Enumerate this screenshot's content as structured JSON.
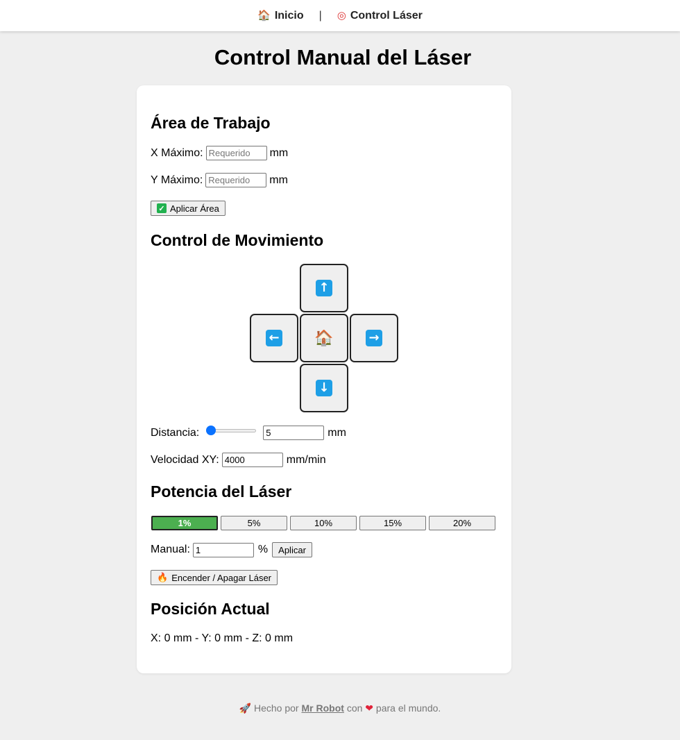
{
  "nav": {
    "home_icon": "house-emoji",
    "home_label": "Inicio",
    "separator": "|",
    "control_icon": "target-emoji",
    "control_label": "Control Láser"
  },
  "page_title": "Control Manual del Láser",
  "work_area": {
    "heading": "Área de Trabajo",
    "x_label": "X Máximo:",
    "x_placeholder": "Requerido",
    "x_unit": "mm",
    "y_label": "Y Máximo:",
    "y_placeholder": "Requerido",
    "y_unit": "mm",
    "apply_icon": "check-box-icon",
    "apply_label": "Aplicar Área"
  },
  "movement": {
    "heading": "Control de Movimiento",
    "up_icon": "arrow-up-icon",
    "left_icon": "arrow-left-icon",
    "home_icon": "house-icon",
    "right_icon": "arrow-right-icon",
    "down_icon": "arrow-down-icon",
    "distance_label": "Distancia:",
    "distance_slider_fraction": 0.0,
    "distance_value": "5",
    "distance_unit": "mm",
    "speed_label": "Velocidad XY:",
    "speed_value": "4000",
    "speed_unit": "mm/min"
  },
  "power": {
    "heading": "Potencia del Láser",
    "presets": [
      "1%",
      "5%",
      "10%",
      "15%",
      "20%"
    ],
    "active_preset": "1%",
    "active_color": "#4caf50",
    "manual_label": "Manual:",
    "manual_value": "1",
    "manual_unit": "%",
    "apply_label": "Aplicar",
    "toggle_icon": "fire-icon",
    "toggle_label": "Encender / Apagar Láser"
  },
  "position": {
    "heading": "Posición Actual",
    "text": "X: 0 mm - Y: 0 mm - Z: 0 mm"
  },
  "footer": {
    "rocket_icon": "rocket-icon",
    "prefix": "Hecho por",
    "author": "Mr Robot",
    "middle": "con",
    "heart_icon": "heart-icon",
    "suffix": "para el mundo."
  }
}
